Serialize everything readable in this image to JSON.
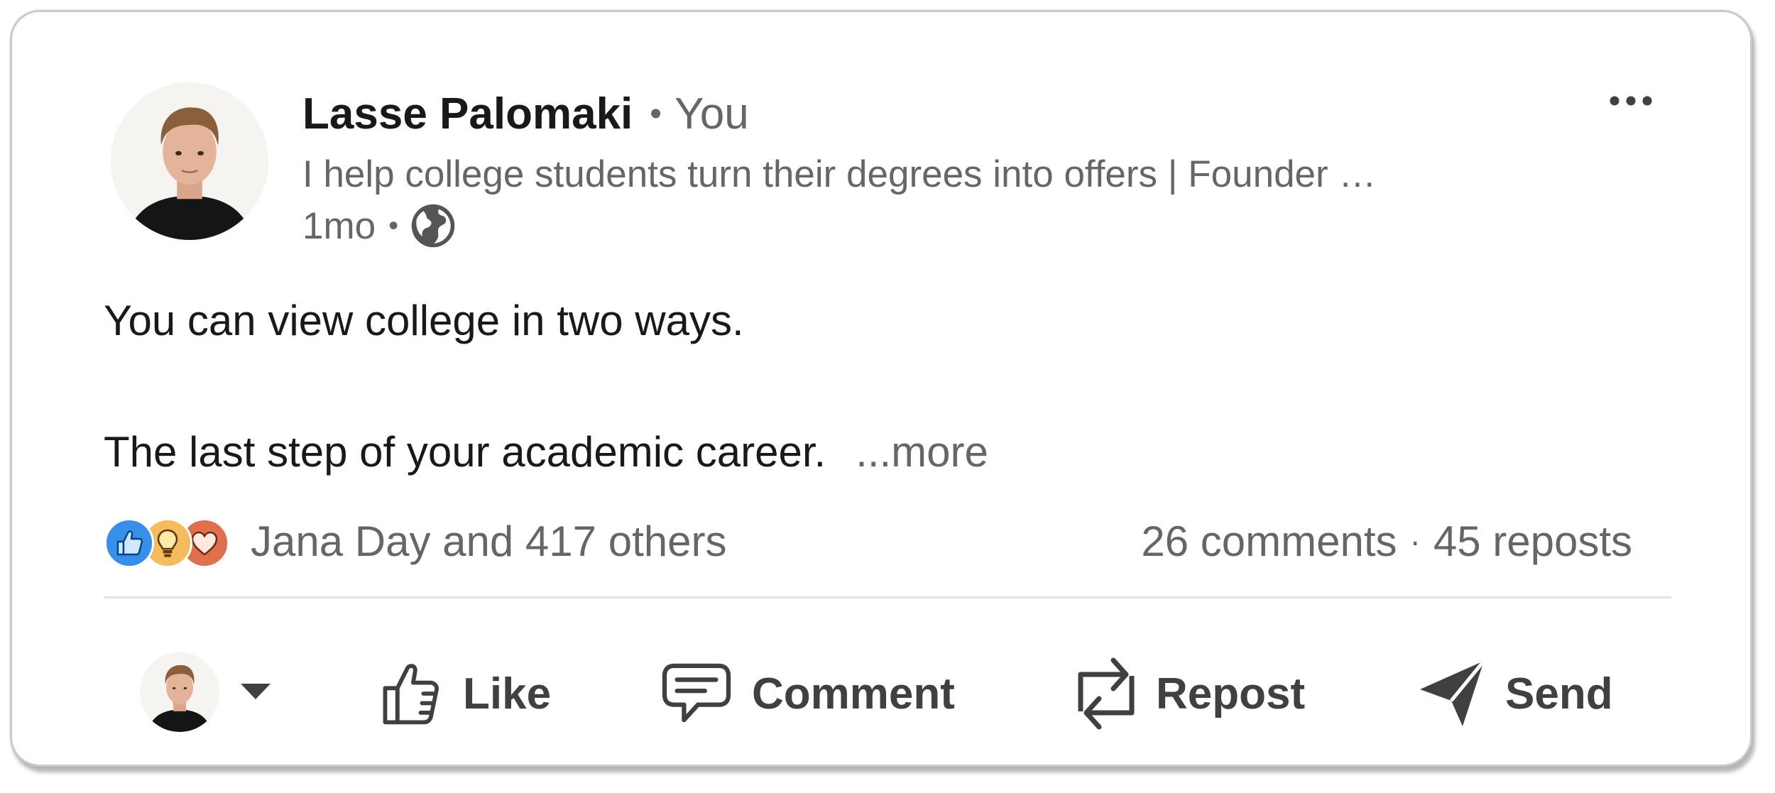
{
  "post": {
    "author": {
      "name": "Lasse Palomaki",
      "separator": "•",
      "relation": "You",
      "headline": "I help college students turn their degrees into offers | Founder …",
      "time": "1mo",
      "time_separator": "•",
      "visibility_icon": "globe-icon"
    },
    "menu_icon": "more-horizontal-icon",
    "body": {
      "line1": "You can view college in two ways.",
      "line2": "The last step of your academic career.",
      "see_more": "...more"
    },
    "social": {
      "reaction_icons": [
        "like-reaction-icon",
        "insightful-reaction-icon",
        "love-reaction-icon"
      ],
      "reactions_text": "Jana Day and 417 others",
      "comments": "26 comments",
      "counts_separator": "·",
      "reposts": "45 reposts"
    },
    "actions": [
      {
        "label": "Like",
        "icon": "thumbs-up-icon"
      },
      {
        "label": "Comment",
        "icon": "comment-icon"
      },
      {
        "label": "Repost",
        "icon": "repost-icon"
      },
      {
        "label": "Send",
        "icon": "send-icon"
      }
    ]
  },
  "colors": {
    "primary_text": "#191919",
    "secondary_text": "#666666",
    "action_text": "#404040",
    "like_blue": "#378fe9",
    "insight_yellow": "#f5bb5c",
    "love_orange": "#df704d"
  }
}
